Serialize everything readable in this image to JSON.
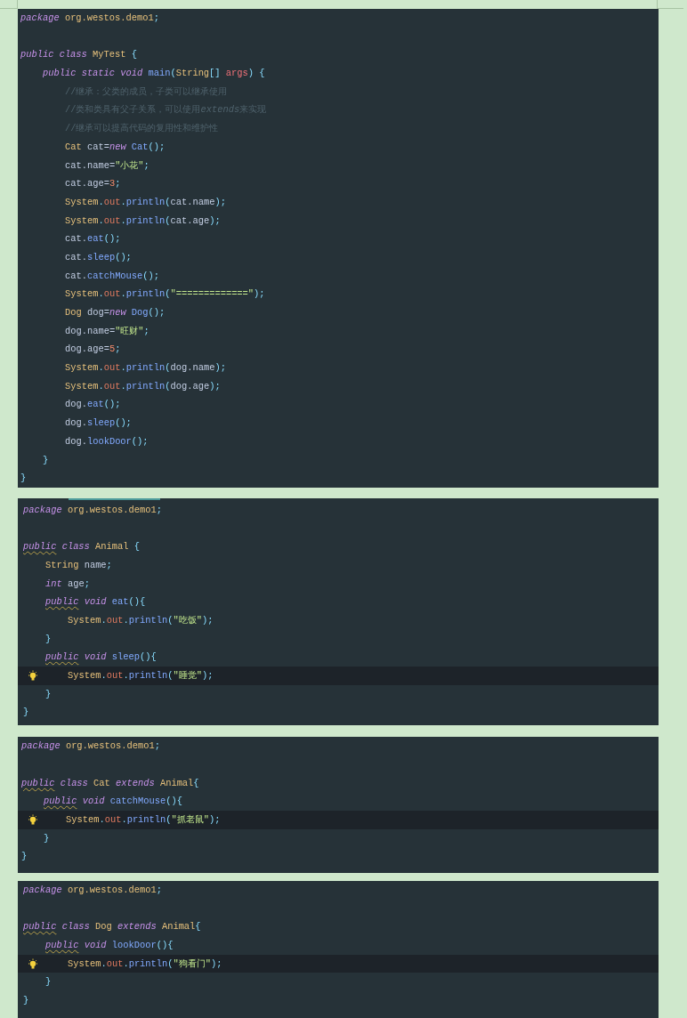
{
  "panels": [
    {
      "tab_indicator": false,
      "lines": [
        {
          "kind": "code",
          "tokens": [
            {
              "kind": "keyword",
              "text": "package"
            },
            {
              "kind": "type",
              "text": " org.westos.demo1"
            },
            {
              "kind": "punct",
              "text": ";"
            }
          ]
        },
        {
          "kind": "blank"
        },
        {
          "kind": "code",
          "tokens": [
            {
              "kind": "keyword",
              "text": "public class"
            },
            {
              "kind": "type",
              "text": " MyTest"
            },
            {
              "kind": "punct",
              "text": " {"
            }
          ],
          "children": [
            {
              "kind": "code",
              "tokens": [
                {
                  "kind": "keyword",
                  "text": "public static void"
                },
                {
                  "kind": "method",
                  "text": " main"
                },
                {
                  "kind": "punct",
                  "text": "("
                },
                {
                  "kind": "type",
                  "text": "String"
                },
                {
                  "kind": "punct",
                  "text": "[]"
                },
                {
                  "kind": "param",
                  "text": " args"
                },
                {
                  "kind": "punct",
                  "text": ") {"
                }
              ],
              "children": [
                {
                  "kind": "code",
                  "tokens": [
                    {
                      "kind": "comment",
                      "text": "//继承：父类的成员，子类可以继承使用"
                    }
                  ]
                },
                {
                  "kind": "code",
                  "tokens": [
                    {
                      "kind": "comment",
                      "text": "//类和类具有父子关系，可以使用"
                    },
                    {
                      "kind": "comment-italic",
                      "text": "extends"
                    },
                    {
                      "kind": "comment",
                      "text": "来实现"
                    }
                  ]
                },
                {
                  "kind": "code",
                  "tokens": [
                    {
                      "kind": "comment",
                      "text": "//继承可以提高代码的复用性和维护性"
                    }
                  ]
                },
                {
                  "kind": "code",
                  "tokens": [
                    {
                      "kind": "type",
                      "text": "Cat"
                    },
                    {
                      "kind": "plain",
                      "text": " cat="
                    },
                    {
                      "kind": "keyword",
                      "text": "new"
                    },
                    {
                      "kind": "method",
                      "text": " Cat"
                    },
                    {
                      "kind": "punct",
                      "text": "();"
                    }
                  ]
                },
                {
                  "kind": "code",
                  "tokens": [
                    {
                      "kind": "plain",
                      "text": "cat.name="
                    },
                    {
                      "kind": "string",
                      "text": "\"小花\""
                    },
                    {
                      "kind": "punct",
                      "text": ";"
                    }
                  ]
                },
                {
                  "kind": "code",
                  "tokens": [
                    {
                      "kind": "plain",
                      "text": "cat.age="
                    },
                    {
                      "kind": "number",
                      "text": "3"
                    },
                    {
                      "kind": "punct",
                      "text": ";"
                    }
                  ]
                },
                {
                  "kind": "code",
                  "tokens": [
                    {
                      "kind": "type",
                      "text": "System"
                    },
                    {
                      "kind": "punct",
                      "text": "."
                    },
                    {
                      "kind": "field",
                      "text": "out"
                    },
                    {
                      "kind": "punct",
                      "text": "."
                    },
                    {
                      "kind": "method",
                      "text": "println"
                    },
                    {
                      "kind": "punct",
                      "text": "("
                    },
                    {
                      "kind": "plain",
                      "text": "cat.name"
                    },
                    {
                      "kind": "punct",
                      "text": ");"
                    }
                  ]
                },
                {
                  "kind": "code",
                  "tokens": [
                    {
                      "kind": "type",
                      "text": "System"
                    },
                    {
                      "kind": "punct",
                      "text": "."
                    },
                    {
                      "kind": "field",
                      "text": "out"
                    },
                    {
                      "kind": "punct",
                      "text": "."
                    },
                    {
                      "kind": "method",
                      "text": "println"
                    },
                    {
                      "kind": "punct",
                      "text": "("
                    },
                    {
                      "kind": "plain",
                      "text": "cat.age"
                    },
                    {
                      "kind": "punct",
                      "text": ");"
                    }
                  ]
                },
                {
                  "kind": "code",
                  "tokens": [
                    {
                      "kind": "plain",
                      "text": "cat."
                    },
                    {
                      "kind": "method",
                      "text": "eat"
                    },
                    {
                      "kind": "punct",
                      "text": "();"
                    }
                  ]
                },
                {
                  "kind": "code",
                  "tokens": [
                    {
                      "kind": "plain",
                      "text": "cat."
                    },
                    {
                      "kind": "method",
                      "text": "sleep"
                    },
                    {
                      "kind": "punct",
                      "text": "();"
                    }
                  ]
                },
                {
                  "kind": "code",
                  "tokens": [
                    {
                      "kind": "plain",
                      "text": "cat."
                    },
                    {
                      "kind": "method",
                      "text": "catchMouse"
                    },
                    {
                      "kind": "punct",
                      "text": "();"
                    }
                  ]
                },
                {
                  "kind": "code",
                  "tokens": [
                    {
                      "kind": "type",
                      "text": "System"
                    },
                    {
                      "kind": "punct",
                      "text": "."
                    },
                    {
                      "kind": "field",
                      "text": "out"
                    },
                    {
                      "kind": "punct",
                      "text": "."
                    },
                    {
                      "kind": "method",
                      "text": "println"
                    },
                    {
                      "kind": "punct",
                      "text": "("
                    },
                    {
                      "kind": "string",
                      "text": "\"=============\""
                    },
                    {
                      "kind": "punct",
                      "text": ");"
                    }
                  ]
                },
                {
                  "kind": "code",
                  "tokens": [
                    {
                      "kind": "type",
                      "text": "Dog"
                    },
                    {
                      "kind": "plain",
                      "text": " dog="
                    },
                    {
                      "kind": "keyword",
                      "text": "new"
                    },
                    {
                      "kind": "method",
                      "text": " Dog"
                    },
                    {
                      "kind": "punct",
                      "text": "();"
                    }
                  ]
                },
                {
                  "kind": "code",
                  "tokens": [
                    {
                      "kind": "plain",
                      "text": "dog.name="
                    },
                    {
                      "kind": "string",
                      "text": "\"旺财\""
                    },
                    {
                      "kind": "punct",
                      "text": ";"
                    }
                  ]
                },
                {
                  "kind": "code",
                  "tokens": [
                    {
                      "kind": "plain",
                      "text": "dog.age="
                    },
                    {
                      "kind": "number",
                      "text": "5"
                    },
                    {
                      "kind": "punct",
                      "text": ";"
                    }
                  ]
                },
                {
                  "kind": "code",
                  "tokens": [
                    {
                      "kind": "type",
                      "text": "System"
                    },
                    {
                      "kind": "punct",
                      "text": "."
                    },
                    {
                      "kind": "field",
                      "text": "out"
                    },
                    {
                      "kind": "punct",
                      "text": "."
                    },
                    {
                      "kind": "method",
                      "text": "println"
                    },
                    {
                      "kind": "punct",
                      "text": "("
                    },
                    {
                      "kind": "plain",
                      "text": "dog.name"
                    },
                    {
                      "kind": "punct",
                      "text": ");"
                    }
                  ]
                },
                {
                  "kind": "code",
                  "tokens": [
                    {
                      "kind": "type",
                      "text": "System"
                    },
                    {
                      "kind": "punct",
                      "text": "."
                    },
                    {
                      "kind": "field",
                      "text": "out"
                    },
                    {
                      "kind": "punct",
                      "text": "."
                    },
                    {
                      "kind": "method",
                      "text": "println"
                    },
                    {
                      "kind": "punct",
                      "text": "("
                    },
                    {
                      "kind": "plain",
                      "text": "dog.age"
                    },
                    {
                      "kind": "punct",
                      "text": ");"
                    }
                  ]
                },
                {
                  "kind": "code",
                  "tokens": [
                    {
                      "kind": "plain",
                      "text": "dog."
                    },
                    {
                      "kind": "method",
                      "text": "eat"
                    },
                    {
                      "kind": "punct",
                      "text": "();"
                    }
                  ]
                },
                {
                  "kind": "code",
                  "tokens": [
                    {
                      "kind": "plain",
                      "text": "dog."
                    },
                    {
                      "kind": "method",
                      "text": "sleep"
                    },
                    {
                      "kind": "punct",
                      "text": "();"
                    }
                  ]
                },
                {
                  "kind": "code",
                  "tokens": [
                    {
                      "kind": "plain",
                      "text": "dog."
                    },
                    {
                      "kind": "method",
                      "text": "lookDoor"
                    },
                    {
                      "kind": "punct",
                      "text": "();"
                    }
                  ]
                }
              ]
            },
            {
              "kind": "code",
              "tokens": [
                {
                  "kind": "punct",
                  "text": "}"
                }
              ]
            }
          ]
        },
        {
          "kind": "code",
          "tokens": [
            {
              "kind": "punct",
              "text": "}"
            }
          ]
        }
      ]
    },
    {
      "tab_indicator": true,
      "lines": [
        {
          "kind": "code",
          "tokens": [
            {
              "kind": "keyword",
              "text": "package"
            },
            {
              "kind": "type",
              "text": " org.westos.demo1"
            },
            {
              "kind": "punct",
              "text": ";"
            }
          ]
        },
        {
          "kind": "blank"
        },
        {
          "kind": "code",
          "tokens": [
            {
              "kind": "keyword-flagged",
              "text": "public"
            },
            {
              "kind": "keyword",
              "text": " class"
            },
            {
              "kind": "type",
              "text": " Animal"
            },
            {
              "kind": "punct",
              "text": " {"
            }
          ],
          "children": [
            {
              "kind": "code",
              "tokens": [
                {
                  "kind": "type",
                  "text": "String"
                },
                {
                  "kind": "plain",
                  "text": " name"
                },
                {
                  "kind": "punct",
                  "text": ";"
                }
              ]
            },
            {
              "kind": "code",
              "tokens": [
                {
                  "kind": "keyword",
                  "text": "int"
                },
                {
                  "kind": "plain",
                  "text": " age"
                },
                {
                  "kind": "punct",
                  "text": ";"
                }
              ]
            },
            {
              "kind": "code",
              "tokens": [
                {
                  "kind": "keyword-flagged",
                  "text": "public"
                },
                {
                  "kind": "keyword",
                  "text": " void"
                },
                {
                  "kind": "method",
                  "text": " eat"
                },
                {
                  "kind": "punct",
                  "text": "(){"
                }
              ],
              "children": [
                {
                  "kind": "code",
                  "tokens": [
                    {
                      "kind": "type",
                      "text": "System"
                    },
                    {
                      "kind": "punct",
                      "text": "."
                    },
                    {
                      "kind": "field",
                      "text": "out"
                    },
                    {
                      "kind": "punct",
                      "text": "."
                    },
                    {
                      "kind": "method",
                      "text": "println"
                    },
                    {
                      "kind": "punct",
                      "text": "("
                    },
                    {
                      "kind": "string",
                      "text": "\"吃饭\""
                    },
                    {
                      "kind": "punct",
                      "text": ");"
                    }
                  ]
                }
              ]
            },
            {
              "kind": "code",
              "tokens": [
                {
                  "kind": "punct",
                  "text": "}"
                }
              ]
            },
            {
              "kind": "code",
              "tokens": [
                {
                  "kind": "keyword-flagged",
                  "text": "public"
                },
                {
                  "kind": "keyword",
                  "text": " void"
                },
                {
                  "kind": "method",
                  "text": " sleep"
                },
                {
                  "kind": "punct",
                  "text": "(){"
                }
              ],
              "children": [
                {
                  "kind": "current",
                  "tokens": [
                    {
                      "kind": "type",
                      "text": "System"
                    },
                    {
                      "kind": "punct",
                      "text": "."
                    },
                    {
                      "kind": "field",
                      "text": "out"
                    },
                    {
                      "kind": "punct",
                      "text": "."
                    },
                    {
                      "kind": "method",
                      "text": "println"
                    },
                    {
                      "kind": "punct",
                      "text": "("
                    },
                    {
                      "kind": "string",
                      "text": "\"睡觉\""
                    },
                    {
                      "kind": "punct",
                      "text": ");"
                    }
                  ]
                }
              ]
            },
            {
              "kind": "code",
              "tokens": [
                {
                  "kind": "punct",
                  "text": "}"
                }
              ]
            }
          ]
        },
        {
          "kind": "code",
          "tokens": [
            {
              "kind": "punct",
              "text": "}"
            }
          ]
        }
      ]
    },
    {
      "tab_indicator": false,
      "lines": [
        {
          "kind": "code",
          "tokens": [
            {
              "kind": "keyword",
              "text": "package"
            },
            {
              "kind": "type",
              "text": " org.westos.demo1"
            },
            {
              "kind": "punct",
              "text": ";"
            }
          ]
        },
        {
          "kind": "blank"
        },
        {
          "kind": "code",
          "tokens": [
            {
              "kind": "keyword-flagged",
              "text": "public"
            },
            {
              "kind": "keyword",
              "text": " class"
            },
            {
              "kind": "type",
              "text": " Cat"
            },
            {
              "kind": "keyword",
              "text": " extends"
            },
            {
              "kind": "type",
              "text": " Animal"
            },
            {
              "kind": "punct",
              "text": "{"
            }
          ],
          "children": [
            {
              "kind": "code",
              "tokens": [
                {
                  "kind": "keyword-flagged",
                  "text": "public"
                },
                {
                  "kind": "keyword",
                  "text": " void"
                },
                {
                  "kind": "method",
                  "text": " catchMouse"
                },
                {
                  "kind": "punct",
                  "text": "(){"
                }
              ],
              "children": [
                {
                  "kind": "current",
                  "tokens": [
                    {
                      "kind": "type",
                      "text": "System"
                    },
                    {
                      "kind": "punct",
                      "text": "."
                    },
                    {
                      "kind": "field",
                      "text": "out"
                    },
                    {
                      "kind": "punct",
                      "text": "."
                    },
                    {
                      "kind": "method",
                      "text": "println"
                    },
                    {
                      "kind": "punct",
                      "text": "("
                    },
                    {
                      "kind": "string",
                      "text": "\"抓老鼠\""
                    },
                    {
                      "kind": "punct",
                      "text": ");"
                    }
                  ]
                }
              ]
            },
            {
              "kind": "code",
              "tokens": [
                {
                  "kind": "punct",
                  "text": "}"
                }
              ]
            }
          ]
        },
        {
          "kind": "code",
          "tokens": [
            {
              "kind": "punct",
              "text": "}"
            }
          ]
        }
      ]
    },
    {
      "tab_indicator": false,
      "lines": [
        {
          "kind": "code",
          "tokens": [
            {
              "kind": "keyword",
              "text": "package"
            },
            {
              "kind": "type",
              "text": " org.westos.demo1"
            },
            {
              "kind": "punct",
              "text": ";"
            }
          ]
        },
        {
          "kind": "blank"
        },
        {
          "kind": "code",
          "tokens": [
            {
              "kind": "keyword-flagged",
              "text": "public"
            },
            {
              "kind": "keyword",
              "text": " class"
            },
            {
              "kind": "type",
              "text": " Dog"
            },
            {
              "kind": "keyword",
              "text": " extends"
            },
            {
              "kind": "type",
              "text": " Animal"
            },
            {
              "kind": "punct",
              "text": "{"
            }
          ],
          "children": [
            {
              "kind": "code",
              "tokens": [
                {
                  "kind": "keyword-flagged",
                  "text": "public"
                },
                {
                  "kind": "keyword",
                  "text": " void"
                },
                {
                  "kind": "method",
                  "text": " lookDoor"
                },
                {
                  "kind": "punct",
                  "text": "(){"
                }
              ],
              "children": [
                {
                  "kind": "current",
                  "tokens": [
                    {
                      "kind": "type",
                      "text": "System"
                    },
                    {
                      "kind": "punct",
                      "text": "."
                    },
                    {
                      "kind": "field",
                      "text": "out"
                    },
                    {
                      "kind": "punct",
                      "text": "."
                    },
                    {
                      "kind": "method",
                      "text": "println"
                    },
                    {
                      "kind": "punct",
                      "text": "("
                    },
                    {
                      "kind": "string",
                      "text": "\"狗看门\""
                    },
                    {
                      "kind": "punct",
                      "text": ");"
                    }
                  ]
                }
              ]
            },
            {
              "kind": "code",
              "tokens": [
                {
                  "kind": "punct",
                  "text": "}"
                }
              ]
            }
          ]
        },
        {
          "kind": "code",
          "tokens": [
            {
              "kind": "punct",
              "text": "}"
            }
          ]
        }
      ]
    }
  ]
}
